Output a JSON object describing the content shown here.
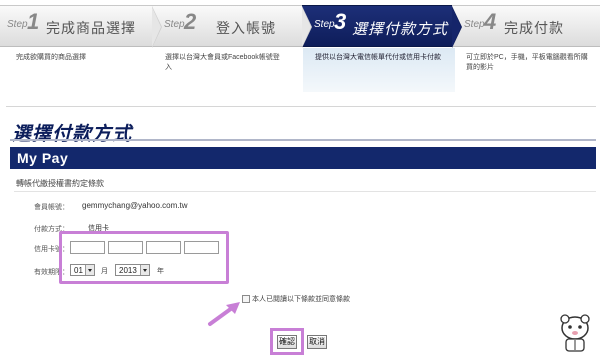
{
  "steps": [
    {
      "word": "Step",
      "num": "1",
      "title": "完成商品選擇",
      "desc": "完成欲購買的商品選擇"
    },
    {
      "word": "Step",
      "num": "2",
      "title": "登入帳號",
      "desc": "選擇以台灣大會員或Facebook帳號登入"
    },
    {
      "word": "Step",
      "num": "3",
      "title": "選擇付款方式",
      "desc": "提供以台灣大電信帳單代付或信用卡付款"
    },
    {
      "word": "Step",
      "num": "4",
      "title": "完成付款",
      "desc": "可立即於PC，手機，平板電腦觀看所購買的影片"
    }
  ],
  "page_title": "選擇付款方式",
  "mypay": "My Pay",
  "auth_link": "轉帳代繳授權書約定條款",
  "form": {
    "account_label": "會員帳號：",
    "account_value": "gemmychang@yahoo.com.tw",
    "method_label": "付款方式：",
    "method_value": "信用卡",
    "card_label": "信用卡號：",
    "expiry_label": "有效期限：",
    "month_value": "01",
    "month_unit": "月",
    "year_value": "2013",
    "year_unit": "年"
  },
  "agree_label": "本人已閱讀以下條款並同意條款",
  "buttons": {
    "confirm": "確認",
    "cancel": "取消"
  },
  "colors": {
    "accent": "#13286c",
    "highlight": "#c87fd6",
    "active_step": "#0e1d5a"
  }
}
